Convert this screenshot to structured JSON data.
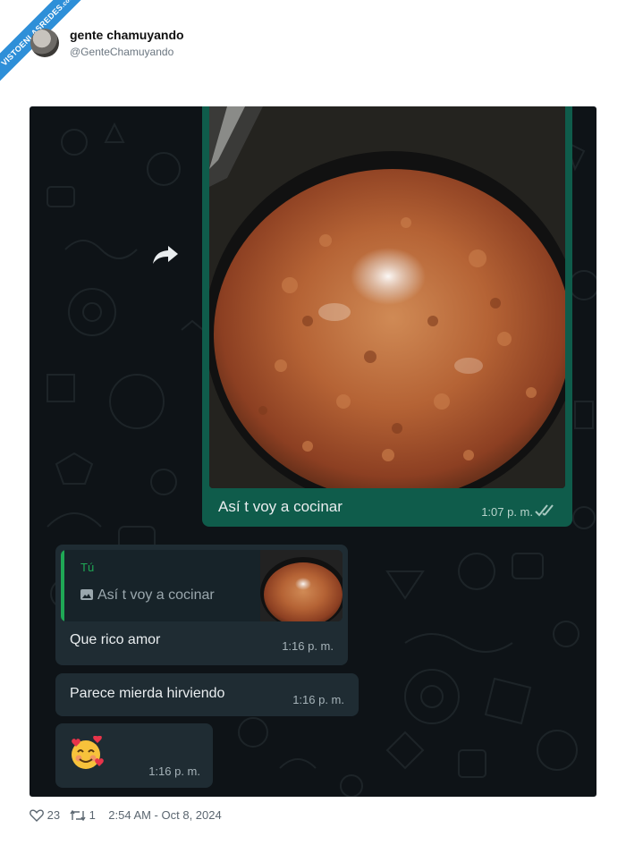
{
  "watermark": {
    "text": "VISTOENLASREDES",
    "suffix": ".com"
  },
  "tweet": {
    "author_name": "gente chamuyando",
    "author_handle": "@GenteChamuyando"
  },
  "chat": {
    "sent_message": {
      "caption": "Así t voy a cocinar",
      "time": "1:07 p. m."
    },
    "reply": {
      "quoted_name": "Tú",
      "quoted_text": "Así t voy a cocinar",
      "text": "Que rico amor",
      "time": "1:16 p. m."
    },
    "message2": {
      "text": "Parece mierda hirviendo",
      "time": "1:16 p. m."
    },
    "message3": {
      "emoji": "smiling-face-with-hearts",
      "time": "1:16 p. m."
    }
  },
  "footer": {
    "likes": "23",
    "retweets": "1",
    "timestamp": "2:54 AM - Oct 8, 2024"
  },
  "colors": {
    "chat_background": "#0e1317",
    "sent_bubble": "#0f5c4b",
    "received_bubble": "#1f2c33",
    "quote_accent": "#1fa855"
  }
}
